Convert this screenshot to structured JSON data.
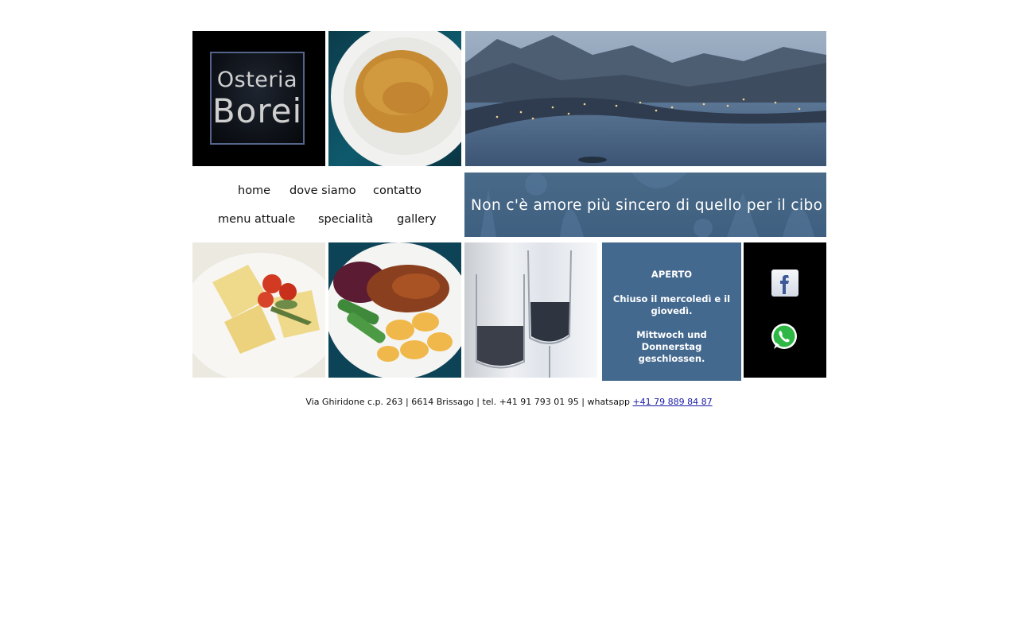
{
  "logo": {
    "line1": "Osteria",
    "line2": "Borei"
  },
  "nav": {
    "row1": [
      "home",
      "dove siamo",
      "contatto"
    ],
    "row2": [
      "menu attuale",
      "specialità",
      "gallery"
    ]
  },
  "banner": {
    "slogan": "Non c'è amore più sincero di quello per il cibo"
  },
  "hours": {
    "title": "APERTO",
    "closed_it": "Chiuso il mercoledì e il giovedì.",
    "closed_de": "Mittwoch und Donnerstag geschlossen."
  },
  "footer": {
    "address": "Via Ghiridone c.p. 263 | 6614 Brissago | tel. +41 91 793 01 95 | whatsapp ",
    "whatsapp_number": "+41 79 889 84 87"
  },
  "icons": {
    "facebook": "facebook-icon",
    "whatsapp": "whatsapp-icon"
  },
  "colors": {
    "accent_blue": "#44698f",
    "banner_blue": "#4a6a89",
    "link": "#1a1aa6"
  }
}
